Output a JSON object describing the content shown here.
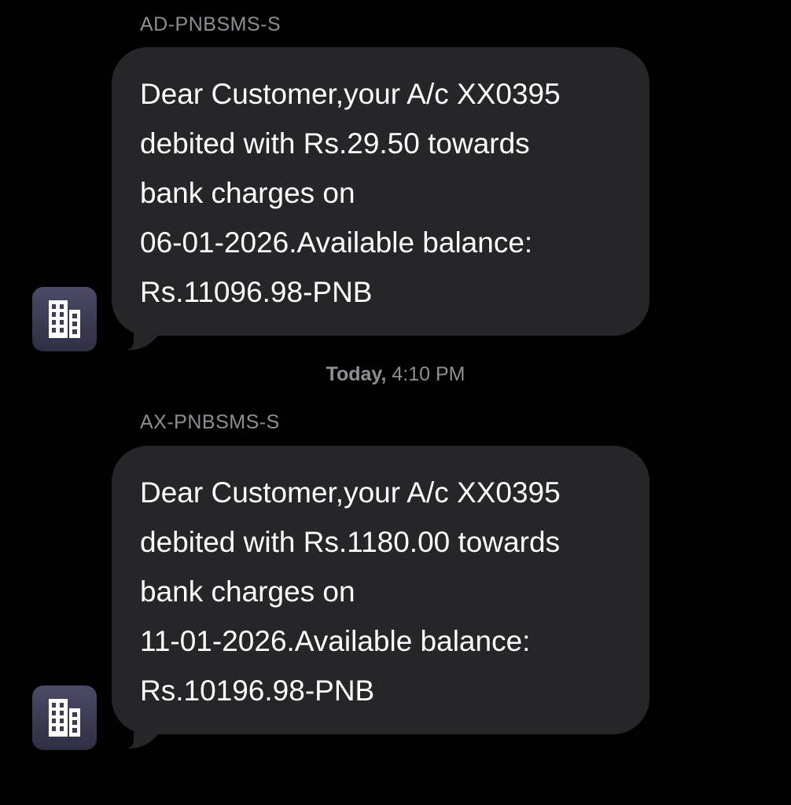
{
  "messages": [
    {
      "sender": "AD-PNBSMS-S",
      "lines": [
        "Dear Customer,your A/c XX0395",
        "debited with Rs.29.50 towards",
        "bank charges on",
        "06-01-2026.Available balance:",
        "Rs.11096.98-PNB"
      ],
      "avatar_icon": "building-icon"
    },
    {
      "sender": "AX-PNBSMS-S",
      "lines": [
        "Dear Customer,your A/c XX0395",
        "debited with Rs.1180.00 towards",
        "bank charges on",
        "11-01-2026.Available balance:",
        "Rs.10196.98-PNB"
      ],
      "avatar_icon": "building-icon"
    }
  ],
  "timestamp": {
    "day": "Today,",
    "time": "4:10 PM"
  },
  "colors": {
    "background": "#000000",
    "bubble": "#262628",
    "secondary_text": "#8e8e93",
    "avatar": "#3d3b55"
  }
}
